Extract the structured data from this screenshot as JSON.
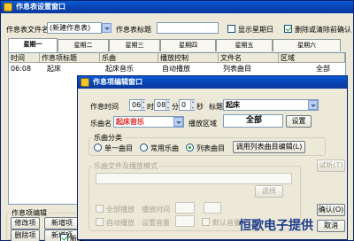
{
  "main_window": {
    "title": "作息表设置窗口",
    "schedule_name_label": "作息表文件名",
    "schedule_name_value": "(新建作息表)",
    "item_title_label": "作息表标题",
    "item_title_value": "",
    "show_weekday_label": "显示星期日",
    "confirm_delete_label": "删除或清除前确认",
    "tabs": [
      "星期一",
      "星期二",
      "星期三",
      "星期四",
      "星期五",
      "星期六"
    ],
    "columns": [
      "时间",
      "作息项标题",
      "乐曲",
      "播放控制",
      "文件名",
      "区域"
    ],
    "rows": [
      [
        "06:08",
        "起床",
        "起床音乐",
        "自动播放",
        "列表曲目",
        "全部"
      ]
    ],
    "edit_group_label": "作息项编辑",
    "buttons": [
      "修改项",
      "新增项",
      "删除项",
      "新增项"
    ],
    "checkbox_partial": "新增"
  },
  "dialog": {
    "title": "作息项编辑窗口",
    "time_label": "作息时间",
    "hour": "06",
    "hour_unit": "时",
    "minute": "08",
    "minute_unit": "分",
    "second": "0",
    "second_unit": "秒",
    "title_label": "标题",
    "title_value": "起床",
    "song_label": "乐曲名",
    "song_value": "起床音乐",
    "area_label": "播放区域",
    "area_value": "全部",
    "settings_button": "设置",
    "category_label": "乐曲分类",
    "category_options": [
      "单一曲目",
      "常用乐曲",
      "列表曲目"
    ],
    "list_editor_button": "调用列表曲目编辑(L)",
    "file_group_label": "乐曲文件及播放模式",
    "select_button": "选择",
    "fullscreen_label": "全部播放",
    "duration_label": "播放时间",
    "auto_play_label": "自动播放",
    "volume_label": "设置音量",
    "default_volume_label": "默认音量",
    "side_buttons": [
      "试听(T)",
      "确认(O)",
      "取消"
    ]
  },
  "watermark": "恒歌电子提供",
  "colors": {
    "title_blue": "#0a46c0",
    "song_red": "#e02020",
    "watermark": "#1b3a8a"
  }
}
